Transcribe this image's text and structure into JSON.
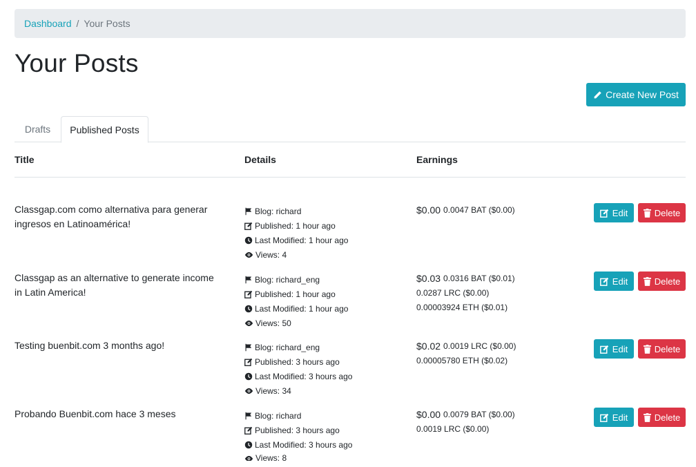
{
  "breadcrumb": {
    "link": "Dashboard",
    "separator": "/",
    "current": "Your Posts"
  },
  "page_title": "Your Posts",
  "create_button": "Create New Post",
  "tabs": {
    "drafts": "Drafts",
    "published": "Published Posts"
  },
  "table": {
    "headers": {
      "title": "Title",
      "details": "Details",
      "earnings": "Earnings"
    },
    "actions": {
      "edit": "Edit",
      "delete": "Delete"
    },
    "rows": [
      {
        "title": "Classgap.com como alternativa para generar ingresos en Latinoamérica!",
        "blog": "Blog: richard",
        "published": "Published: 1 hour ago",
        "modified": "Last Modified: 1 hour ago",
        "views": "Views: 4",
        "total": "$0.00",
        "earn1": "0.0047 BAT ($0.00)"
      },
      {
        "title": "Classgap as an alternative to generate income in Latin America!",
        "blog": "Blog: richard_eng",
        "published": "Published: 1 hour ago",
        "modified": "Last Modified: 1 hour ago",
        "views": "Views: 50",
        "total": "$0.03",
        "earn1": "0.0316 BAT ($0.01)",
        "earn2": "0.0287 LRC ($0.00)",
        "earn3": "0.00003924 ETH ($0.01)"
      },
      {
        "title": "Testing buenbit.com 3 months ago!",
        "blog": "Blog: richard_eng",
        "published": "Published: 3 hours ago",
        "modified": "Last Modified: 3 hours ago",
        "views": "Views: 34",
        "total": "$0.02",
        "earn1": "0.0019 LRC ($0.00)",
        "earn2": "0.00005780 ETH ($0.02)"
      },
      {
        "title": "Probando Buenbit.com hace 3 meses",
        "blog": "Blog: richard",
        "published": "Published: 3 hours ago",
        "modified": "Last Modified: 3 hours ago",
        "views": "Views: 8",
        "total": "$0.00",
        "earn1": "0.0079 BAT ($0.00)",
        "earn2": "0.0019 LRC ($0.00)"
      }
    ]
  },
  "colors": {
    "info": "#17a2b8",
    "danger": "#dc3545",
    "breadcrumb_bg": "#e9ecef"
  }
}
